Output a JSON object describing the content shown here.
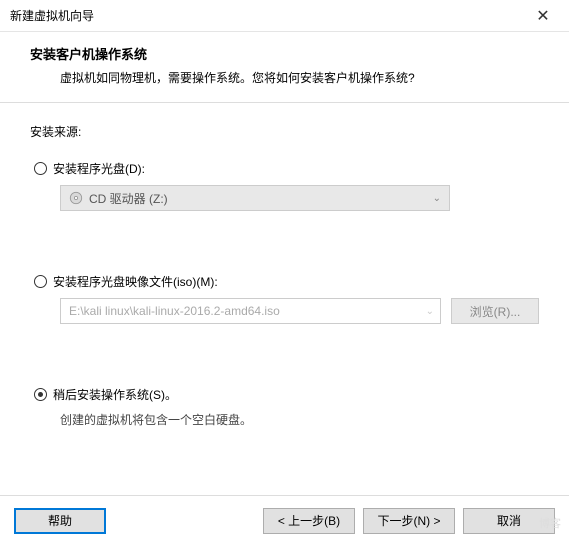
{
  "window": {
    "title": "新建虚拟机向导"
  },
  "header": {
    "title": "安装客户机操作系统",
    "desc": "虚拟机如同物理机，需要操作系统。您将如何安装客户机操作系统?"
  },
  "content": {
    "source_label": "安装来源:",
    "opt_disc": {
      "label": "安装程序光盘(D):",
      "cd_label": "CD 驱动器 (Z:)"
    },
    "opt_iso": {
      "label": "安装程序光盘映像文件(iso)(M):",
      "path": "E:\\kali linux\\kali-linux-2016.2-amd64.iso",
      "browse": "浏览(R)..."
    },
    "opt_later": {
      "label": "稍后安装操作系统(S)。",
      "desc": "创建的虚拟机将包含一个空白硬盘。"
    }
  },
  "footer": {
    "help": "帮助",
    "back": "< 上一步(B)",
    "next": "下一步(N) >",
    "cancel": "取消"
  },
  "watermark": "博客"
}
